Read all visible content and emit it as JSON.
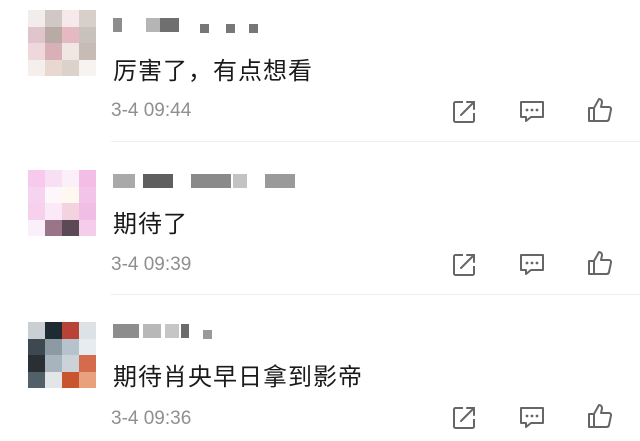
{
  "comments": [
    {
      "text": "厉害了，有点想看",
      "time": "3-4 09:44",
      "avatar_colors": [
        "#f2ecea",
        "#cfc8c4",
        "#f5e9ec",
        "#d8cfc9",
        "#e0c6cc",
        "#b8aaa4",
        "#e6b8c1",
        "#c9c1bb",
        "#eed8dc",
        "#d9b0b8",
        "#f0e6e2",
        "#c6bcb5",
        "#f4efed",
        "#e8d8d0",
        "#dcd2cc",
        "#f7f3f1"
      ]
    },
    {
      "text": "期待了",
      "time": "3-4 09:39",
      "avatar_colors": [
        "#f7c9ec",
        "#f9dff4",
        "#fbeffa",
        "#f3bde6",
        "#f6d4ef",
        "#fdf7fc",
        "#fff8ee",
        "#f3c4e9",
        "#f7d0ee",
        "#fbe9f7",
        "#f4d3e0",
        "#f0bde4",
        "#fbeff9",
        "#9a7487",
        "#5b4a55",
        "#f5cdeb"
      ]
    },
    {
      "text": "期待肖央早日拿到影帝",
      "time": "3-4 09:36",
      "avatar_colors": [
        "#c9cfd2",
        "#1f2b33",
        "#b94237",
        "#dde2e6",
        "#3d4850",
        "#8c9aa3",
        "#b7c3cc",
        "#e7ecef",
        "#2a2f34",
        "#a7b4bd",
        "#cbd3d8",
        "#d56a4c",
        "#516069",
        "#e2e6e9",
        "#c9552f",
        "#e9a07d"
      ]
    }
  ],
  "actions": {
    "share": "share-icon",
    "reply": "comment-icon",
    "like": "thumbs-up-icon"
  }
}
